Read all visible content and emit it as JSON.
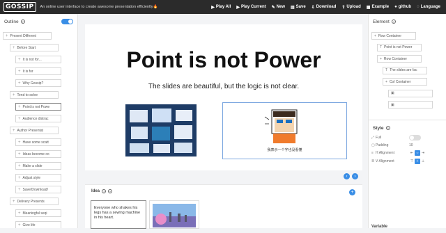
{
  "header": {
    "logo": "GOSSIP",
    "tagline": "An online user interface to create awesome presentation efficiently🔥",
    "menu": [
      {
        "icon": "▶",
        "label": "Play All"
      },
      {
        "icon": "▶",
        "label": "Play Current"
      },
      {
        "icon": "✎",
        "label": "New"
      },
      {
        "icon": "▤",
        "label": "Save"
      },
      {
        "icon": "⇩",
        "label": "Download"
      },
      {
        "icon": "⇧",
        "label": "Upload"
      },
      {
        "icon": "▦",
        "label": "Example"
      },
      {
        "icon": "●",
        "label": "github"
      },
      {
        "icon": "◌",
        "label": "Language"
      }
    ]
  },
  "outline": {
    "title": "Outline",
    "help": "?",
    "toggle_on": true,
    "items": [
      {
        "label": "Present Different",
        "level": 0
      },
      {
        "label": "Before Start",
        "level": 1
      },
      {
        "label": "It is not for...",
        "level": 2
      },
      {
        "label": "It is for",
        "level": 2
      },
      {
        "label": "Why Gossip?",
        "level": 2
      },
      {
        "label": "Tend to solve",
        "level": 1
      },
      {
        "label": "Point is not Powe",
        "level": 2,
        "active": true
      },
      {
        "label": "Audience distrac",
        "level": 2
      },
      {
        "label": "Author Presentat",
        "level": 1
      },
      {
        "label": "Have some scatt",
        "level": 2
      },
      {
        "label": "Ideas become co",
        "level": 2
      },
      {
        "label": "Make a slide",
        "level": 2
      },
      {
        "label": "Adjust style",
        "level": 2
      },
      {
        "label": "Save/Download/",
        "level": 2
      },
      {
        "label": "Delivery Presents",
        "level": 1
      },
      {
        "label": "Meaningful seqi",
        "level": 2
      },
      {
        "label": "Give life",
        "level": 2
      }
    ]
  },
  "slide": {
    "title": "Point is not Power",
    "subtitle": "The slides are beautiful, but the logic is not clear.",
    "cartoon_caption": "我表示一个字也没看懂"
  },
  "idea": {
    "title": "Idea",
    "card_text": "Everyone who shakes his legs has a sewing machine in his heart."
  },
  "element": {
    "title": "Element",
    "help": "?",
    "items": [
      {
        "label": "Row Container",
        "icon": "+",
        "level": 0
      },
      {
        "label": "Point is not Power",
        "icon": "T",
        "level": 1
      },
      {
        "label": "Row Container",
        "icon": "+",
        "level": 1
      },
      {
        "label": "The slides are fac",
        "icon": "T",
        "level": 2
      },
      {
        "label": "Col Container",
        "icon": "+",
        "level": 2
      },
      {
        "label": "",
        "icon": "▣",
        "level": 3
      },
      {
        "label": "",
        "icon": "▣",
        "level": 3
      }
    ]
  },
  "style": {
    "title": "Style",
    "help": "?",
    "full_label": "Full",
    "padding_label": "Padding",
    "padding_value": "10",
    "h_align_label": "H Alignment",
    "v_align_label": "V Alignment"
  },
  "variable": {
    "title": "Variable"
  },
  "colors": {
    "accent": "#3a8ee6",
    "topbar": "#2b2b2b"
  }
}
